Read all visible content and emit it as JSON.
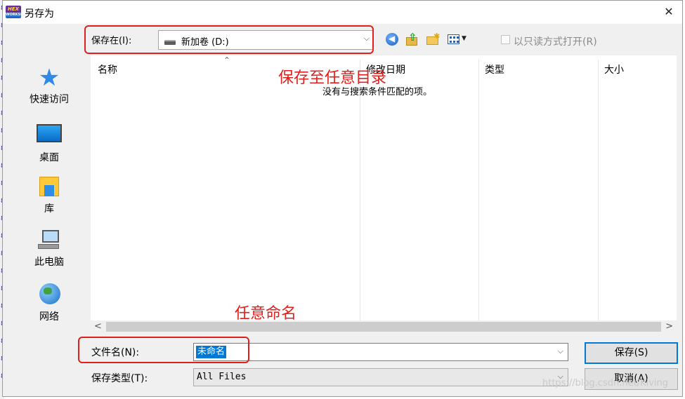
{
  "window": {
    "title": "另存为",
    "close_symbol": "✕",
    "app_icon_text_1": "HEX",
    "app_icon_text_2": "WORKSHOP"
  },
  "toolbar": {
    "save_in_label": "保存在(I):",
    "location_value": "新加卷 (D:)",
    "dropdown_symbol": "⌵",
    "back_icon": "back-arrow-icon",
    "up_icon": "up-folder-icon",
    "new_folder_icon": "new-folder-icon",
    "views_icon": "view-menu-icon",
    "readonly_label": "以只读方式打开(R)",
    "readonly_checked": false
  },
  "places": [
    {
      "label": "快速访问",
      "icon": "star-icon"
    },
    {
      "label": "桌面",
      "icon": "desktop-icon"
    },
    {
      "label": "库",
      "icon": "library-icon"
    },
    {
      "label": "此电脑",
      "icon": "computer-icon"
    },
    {
      "label": "网络",
      "icon": "network-icon"
    }
  ],
  "filelist": {
    "columns": [
      "名称",
      "修改日期",
      "类型",
      "大小"
    ],
    "sort_indicator": "⌃",
    "empty_message": "没有与搜索条件匹配的项。",
    "scroll_left": "<",
    "scroll_right": ">"
  },
  "fields": {
    "filename_label": "文件名(N):",
    "filename_value": "未命名",
    "filetype_label": "保存类型(T):",
    "filetype_value": "All Files"
  },
  "buttons": {
    "save": "保存(S)",
    "cancel": "取消(A)"
  },
  "annotations": {
    "top_note": "保存至任意目录",
    "bottom_note": "任意命名",
    "color": "#e0201c"
  },
  "watermark": "https://blog.csdn.net/Kiving",
  "colors": {
    "dialog_bg": "#f0f0f0",
    "selection": "#0078d7"
  }
}
